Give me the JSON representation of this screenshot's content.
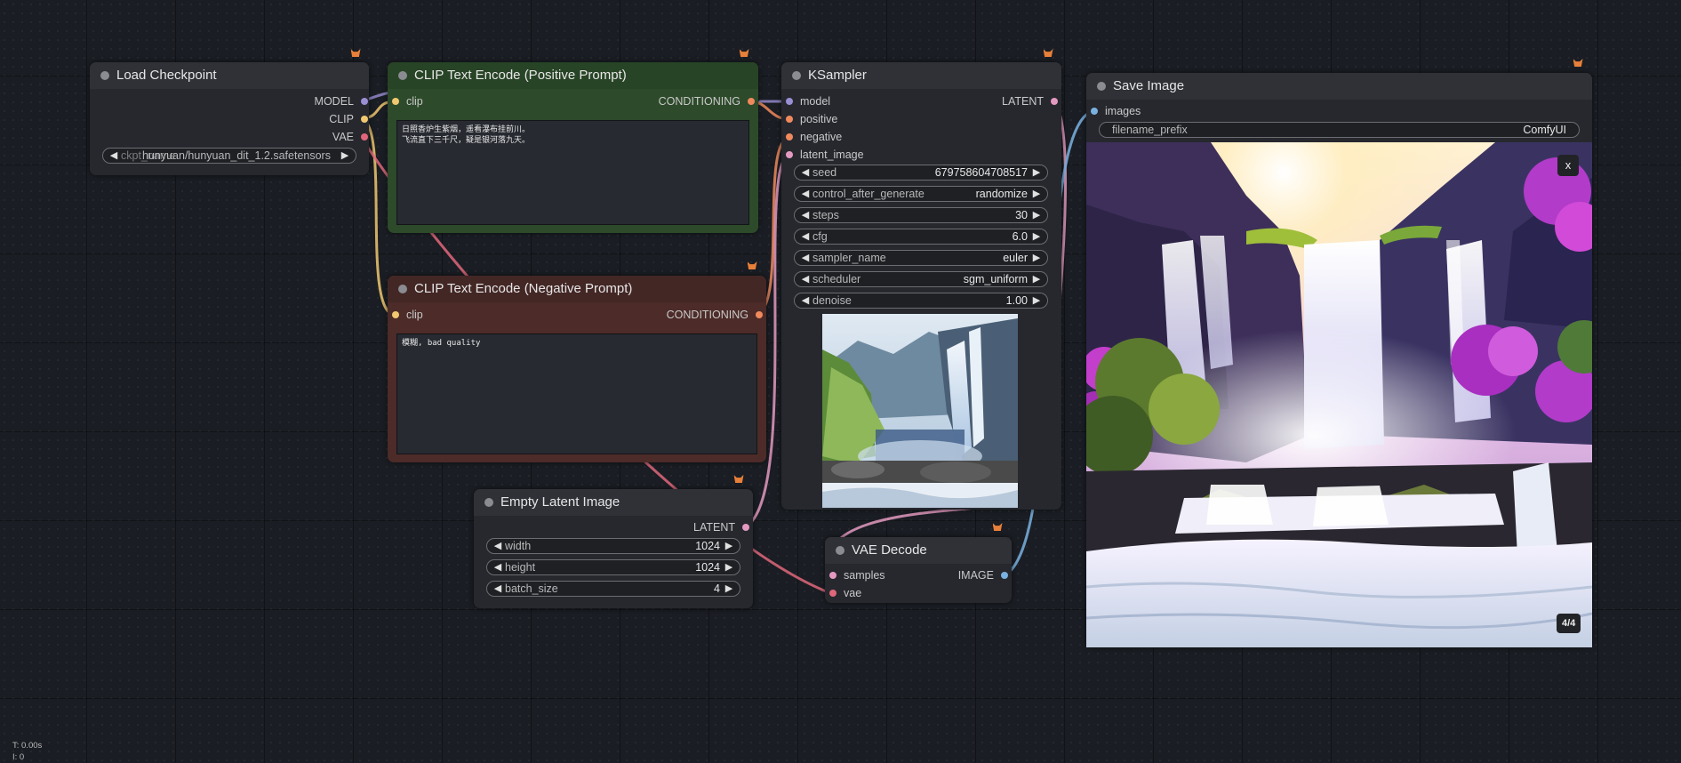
{
  "nodes": {
    "load_checkpoint": {
      "title": "Load Checkpoint",
      "outputs": [
        "MODEL",
        "CLIP",
        "VAE"
      ],
      "ckpt_name": {
        "label": "ckpt_name",
        "value": "hunyuan/hunyuan_dit_1.2.safetensors"
      }
    },
    "clip_positive": {
      "title": "CLIP Text Encode (Positive Prompt)",
      "input": "clip",
      "output": "CONDITIONING",
      "text": "日照香炉生紫烟，遥看瀑布挂前川。\n飞流直下三千尺，疑是银河落九天。",
      "color": "#2d4a2a"
    },
    "clip_negative": {
      "title": "CLIP Text Encode (Negative Prompt)",
      "input": "clip",
      "output": "CONDITIONING",
      "text": "模糊, bad quality",
      "color": "#4c2b28"
    },
    "ksampler": {
      "title": "KSampler",
      "inputs": [
        "model",
        "positive",
        "negative",
        "latent_image"
      ],
      "output": "LATENT",
      "widgets": [
        {
          "label": "seed",
          "value": "679758604708517"
        },
        {
          "label": "control_after_generate",
          "value": "randomize"
        },
        {
          "label": "steps",
          "value": "30"
        },
        {
          "label": "cfg",
          "value": "6.0"
        },
        {
          "label": "sampler_name",
          "value": "euler"
        },
        {
          "label": "scheduler",
          "value": "sgm_uniform"
        },
        {
          "label": "denoise",
          "value": "1.00"
        }
      ]
    },
    "empty_latent": {
      "title": "Empty Latent Image",
      "output": "LATENT",
      "widgets": [
        {
          "label": "width",
          "value": "1024"
        },
        {
          "label": "height",
          "value": "1024"
        },
        {
          "label": "batch_size",
          "value": "4"
        }
      ]
    },
    "vae_decode": {
      "title": "VAE Decode",
      "inputs": [
        "samples",
        "vae"
      ],
      "output": "IMAGE"
    },
    "save_image": {
      "title": "Save Image",
      "input": "images",
      "filename_prefix": {
        "label": "filename_prefix",
        "value": "ComfyUI"
      },
      "close_label": "x",
      "counter": "4/4"
    }
  },
  "stats": {
    "time": "T: 0.00s",
    "iter": "I: 0"
  },
  "colors": {
    "model": "#9a8fd4",
    "clip": "#f0c870",
    "vae": "#e0677b",
    "conditioning": "#f08a5d",
    "latent": "#e49ac0",
    "image": "#7ab1e0"
  }
}
